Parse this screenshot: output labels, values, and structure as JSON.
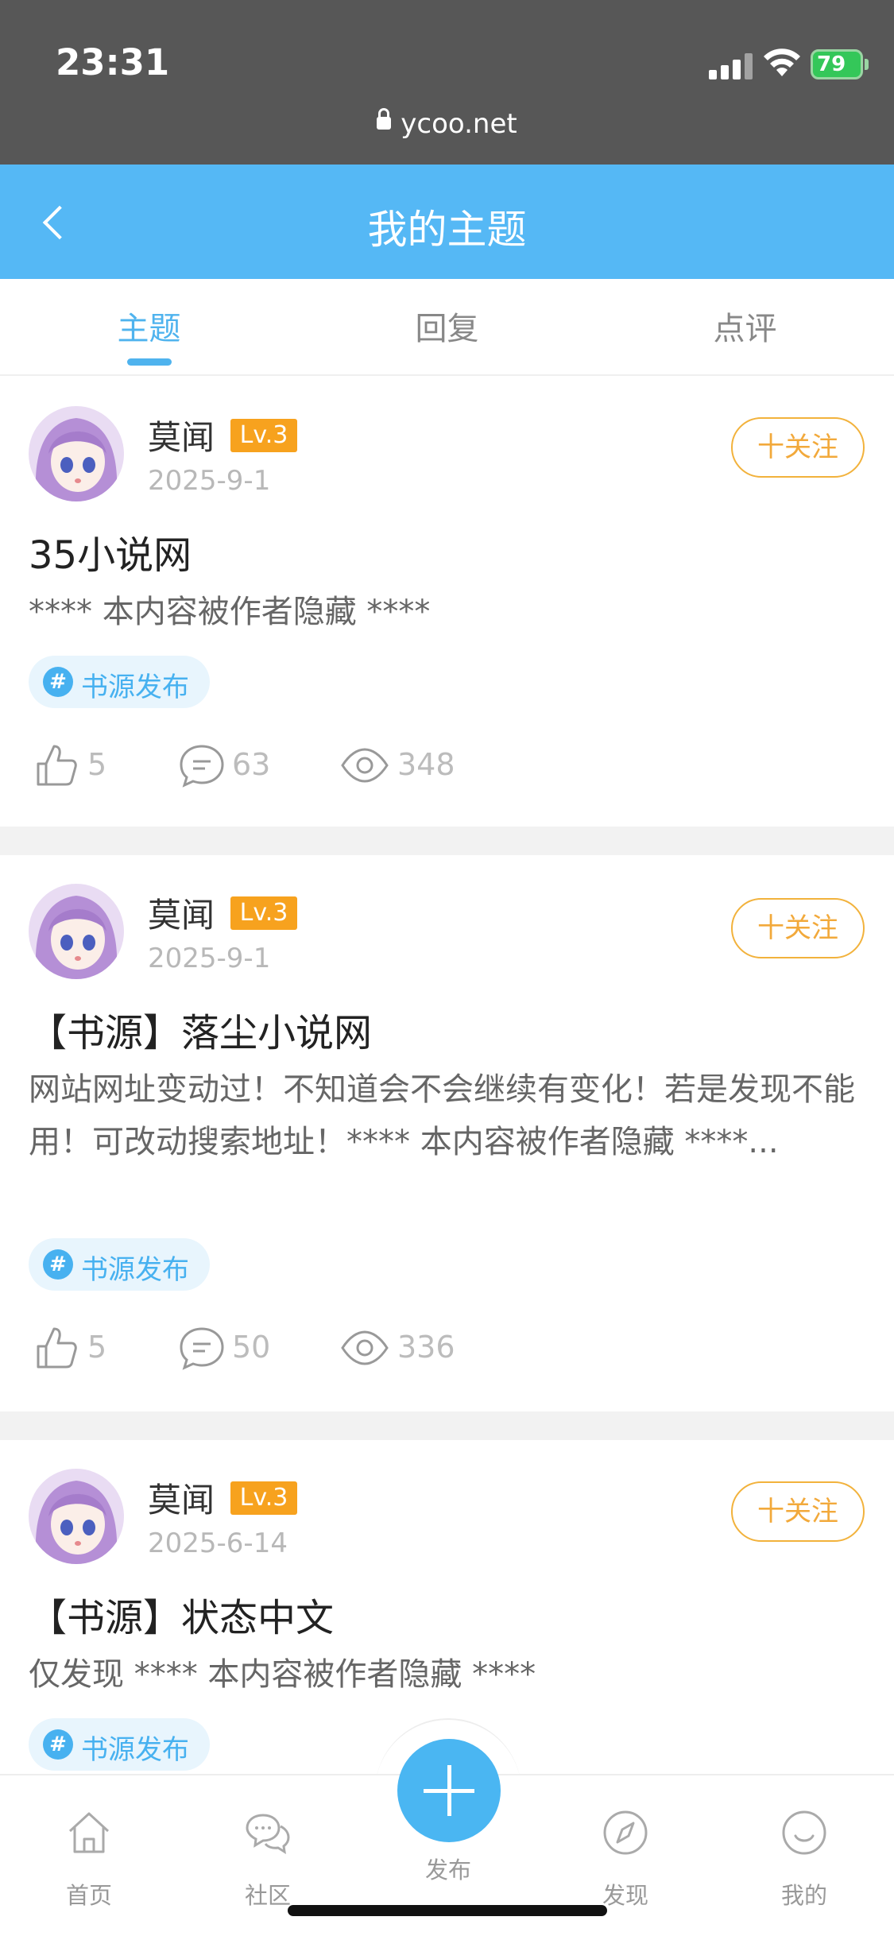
{
  "status_bar": {
    "time": "23:31",
    "battery": "79",
    "url": "ycoo.net"
  },
  "header": {
    "title": "我的主题"
  },
  "tabs": [
    {
      "label": "主题",
      "active": true
    },
    {
      "label": "回复",
      "active": false
    },
    {
      "label": "点评",
      "active": false
    }
  ],
  "posts": [
    {
      "author": "莫闻",
      "level": "Lv.3",
      "date": "2025-9-1",
      "follow_label": "十关注",
      "title": "35小说网",
      "body": "**** 本内容被作者隐藏 ****",
      "tag": "书源发布",
      "likes": "5",
      "comments": "63",
      "views": "348"
    },
    {
      "author": "莫闻",
      "level": "Lv.3",
      "date": "2025-9-1",
      "follow_label": "十关注",
      "title": "【书源】落尘小说网",
      "body": "网站网址变动过！不知道会不会继续有变化！若是发现不能用！可改动搜索地址！**** 本内容被作者隐藏 ****...",
      "tag": "书源发布",
      "likes": "5",
      "comments": "50",
      "views": "336"
    },
    {
      "author": "莫闻",
      "level": "Lv.3",
      "date": "2025-6-14",
      "follow_label": "十关注",
      "title": "【书源】状态中文",
      "body": "仅发现 **** 本内容被作者隐藏 ****",
      "tag": "书源发布"
    }
  ],
  "bottom_nav": [
    {
      "label": "首页",
      "icon": "home-icon"
    },
    {
      "label": "社区",
      "icon": "community-icon"
    },
    {
      "label": "发布",
      "icon": "plus-icon"
    },
    {
      "label": "发现",
      "icon": "compass-icon"
    },
    {
      "label": "我的",
      "icon": "smile-icon"
    }
  ],
  "colors": {
    "accent": "#55b8f5",
    "level_badge": "#f7a21e",
    "follow": "#f2b23c"
  }
}
